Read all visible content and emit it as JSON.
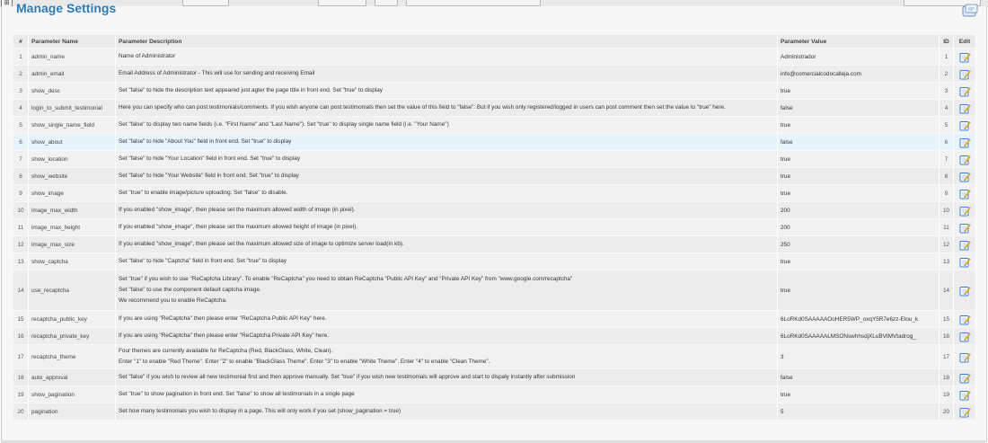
{
  "page": {
    "title": "Manage Settings"
  },
  "colors": {
    "title": "#2b7bb9",
    "row_highlight": "#e7f3fb",
    "edit_icon_blue": "#3a7fd5",
    "edit_icon_yellow": "#f3c623"
  },
  "table": {
    "headers": {
      "num": "#",
      "name": "Parameter Name",
      "description": "Parameter Description",
      "value": "Parameter Value",
      "id": "ID",
      "edit": "Edit"
    },
    "rows": [
      {
        "num": "1",
        "name": "admin_name",
        "desc": [
          "Name of Administrator"
        ],
        "value": "Administrador",
        "id": "1"
      },
      {
        "num": "2",
        "name": "admin_email",
        "desc": [
          "Email Address of Administrator - This will use for sending and receiving Email"
        ],
        "value": "info@comercialcodocalleja.com",
        "id": "2"
      },
      {
        "num": "3",
        "name": "show_desc",
        "desc": [
          "Set \"false\" to hide the description text appeared just agter the page title in front end. Set \"true\" to display"
        ],
        "value": "true",
        "id": "3"
      },
      {
        "num": "4",
        "name": "login_to_submit_testimonial",
        "desc": [
          "Here you can specify who can post testimonials/comments. If you wish anyone can post testimonials then set the value of this field to \"false\". But if you wish only registered/logged in users can post comment then set the value to \"true\" here."
        ],
        "value": "false",
        "id": "4"
      },
      {
        "num": "5",
        "name": "show_single_name_field",
        "desc": [
          "Set \"false\" to display two name fields (i.e. \"First Name\" and \"Last Name\"). Set \"true\" to display single name field (i.e. \"Your Name\")"
        ],
        "value": "true",
        "id": "5"
      },
      {
        "num": "6",
        "name": "show_about",
        "desc": [
          "Set \"false\" to hide \"About You\" field in front end. Set \"true\" to display"
        ],
        "value": "false",
        "id": "6"
      },
      {
        "num": "7",
        "name": "show_location",
        "desc": [
          "Set \"false\" to hide \"Your Location\" field in front end. Set \"true\" to display"
        ],
        "value": "true",
        "id": "7"
      },
      {
        "num": "8",
        "name": "show_website",
        "desc": [
          "Set \"false\" to hide \"Your Website\" field in front end. Set \"true\" to display"
        ],
        "value": "true",
        "id": "8"
      },
      {
        "num": "9",
        "name": "show_image",
        "desc": [
          "Set \"true\" to enable image/picture uploading. Set \"false\" to disable."
        ],
        "value": "true",
        "id": "9"
      },
      {
        "num": "10",
        "name": "image_max_width",
        "desc": [
          "If you enabled \"show_image\", then please set the maximum allowed width of image (in pixel)."
        ],
        "value": "200",
        "id": "10"
      },
      {
        "num": "11",
        "name": "image_max_height",
        "desc": [
          "If you enabled \"show_image\", then please set the maximum allowed height of image (in pixel)."
        ],
        "value": "200",
        "id": "11"
      },
      {
        "num": "12",
        "name": "image_max_size",
        "desc": [
          "If you enabled \"show_image\", then please set the maximum allowed size of image to optimize server load(in kb)."
        ],
        "value": "250",
        "id": "12"
      },
      {
        "num": "13",
        "name": "show_captcha",
        "desc": [
          "Set \"false\" to hide \"Captcha\" field in front end. Set \"true\" to display"
        ],
        "value": "true",
        "id": "13"
      },
      {
        "num": "14",
        "name": "use_recaptcha",
        "desc": [
          "Set \"true\" if you wish to use \"ReCaptcha Library\". To enable \"ReCaptcha\" you need to obtain ReCaptcha \"Public API Key\" and \"Private API Key\" from \"www.google.com/recaptcha\"",
          "Set \"false\" to use the component default captcha image.",
          "We recommend you to enable ReCaptcha."
        ],
        "value": "true",
        "id": "14"
      },
      {
        "num": "15",
        "name": "recaptcha_public_key",
        "desc": [
          "If you are using \"ReCaptcha\" then please enter \"ReCaptcha Public API Key\" here."
        ],
        "value": "6LoRKd0SAAAAAOoHER5WP_oxqY5R7e6zz-Elou_k",
        "id": "15"
      },
      {
        "num": "16",
        "name": "recaptcha_private_key",
        "desc": [
          "If you are using \"ReCaptcha\" then please enter \"ReCaptcha Private API Key\" here."
        ],
        "value": "6LoRKd0SAAAAALMSONswhhsdjXLuBVtMVtadrog_",
        "id": "16"
      },
      {
        "num": "17",
        "name": "recaptcha_theme",
        "desc": [
          "Four themes are currently available for ReCaptcha (Red, BlackGlass, White, Clean).",
          "Enter \"1\" to enable \"Red Theme\". Enter \"2\" to enable \"BlackGlass Theme\". Enter \"3\" to enable \"White Theme\". Enter \"4\" to enable \"Clean Theme\"."
        ],
        "value": "3",
        "id": "17"
      },
      {
        "num": "18",
        "name": "auto_approval",
        "desc": [
          "Set \"false\" if you wish to review all new testimonial first and then approve manually. Set \"true\" if you wish new testimonials will approve and start to dispaly instantly after submission"
        ],
        "value": "false",
        "id": "18"
      },
      {
        "num": "19",
        "name": "show_pagination",
        "desc": [
          "Set \"true\" to show pagination in front end. Set \"false\" to show all testimonials in a single page"
        ],
        "value": "true",
        "id": "19"
      },
      {
        "num": "20",
        "name": "pagination",
        "desc": [
          "Set how many testimonials you wish to display in a page. This will only work if you set (show_pagination = true)"
        ],
        "value": "5",
        "id": "20"
      }
    ]
  }
}
